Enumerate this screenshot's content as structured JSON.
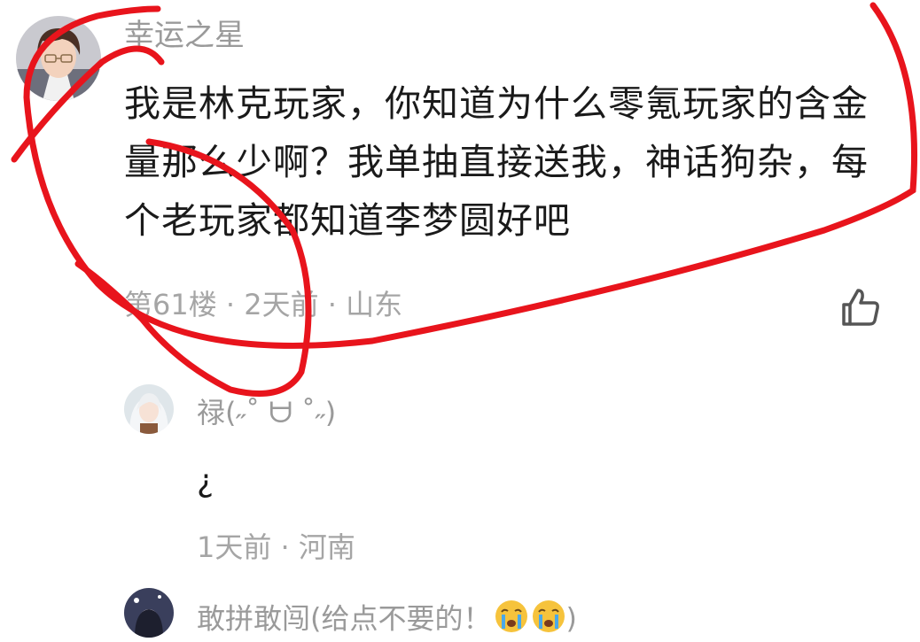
{
  "main_comment": {
    "username": "幸运之星",
    "text": "我是林克玩家，你知道为什么零氪玩家的含金量那么少啊？我单抽直接送我，神话狗杂，每个老玩家都知道李梦圆好吧",
    "meta": "第61楼 · 2天前 · 山东",
    "like_icon": "thumbs-up-icon"
  },
  "replies": [
    {
      "username": "禄(˶˚ ᗨ ˚˶)",
      "text": "¿",
      "meta": "1天前 · 河南"
    },
    {
      "username": "敢拼敢闯(给点不要的！",
      "username_suffix": ")",
      "emoji_icon": "crying-face-icon"
    }
  ],
  "colors": {
    "annotation": "#e8141c",
    "text_primary": "#1a1a1a",
    "text_secondary": "#9a9a9a"
  }
}
